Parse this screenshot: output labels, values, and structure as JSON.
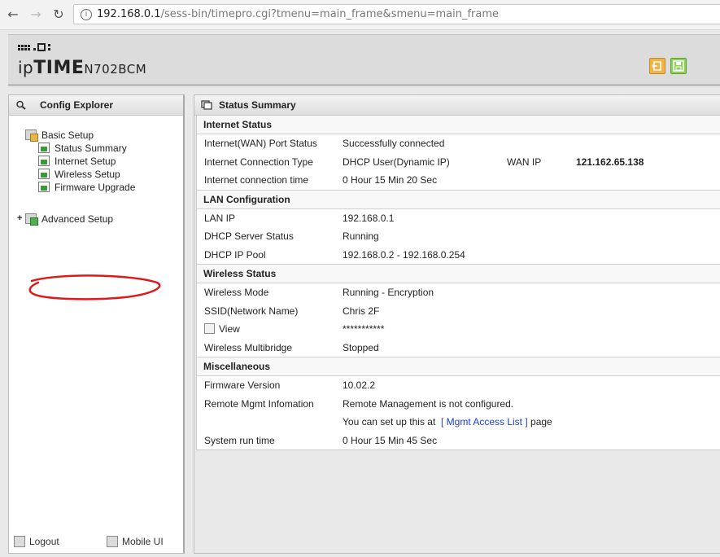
{
  "browser": {
    "url_host": "192.168.0.1",
    "url_path": "/sess-bin/timepro.cgi?tmenu=main_frame&smenu=main_frame"
  },
  "header": {
    "logo_ip": "ip",
    "logo_time": "TIME",
    "logo_model": "N702BCM"
  },
  "sidebar": {
    "title": "Config Explorer",
    "basic_setup": "Basic Setup",
    "items": [
      {
        "label": "Status Summary"
      },
      {
        "label": "Internet Setup"
      },
      {
        "label": "Wireless Setup"
      },
      {
        "label": "Firmware Upgrade"
      }
    ],
    "advanced_setup": "Advanced Setup",
    "expand_symbol": "+",
    "logout": "Logout",
    "mobile_ui": "Mobile UI"
  },
  "main": {
    "title": "Status Summary",
    "sections": {
      "internet": {
        "title": "Internet Status",
        "port_status_label": "Internet(WAN) Port Status",
        "port_status_value": "Successfully connected",
        "conn_type_label": "Internet Connection Type",
        "conn_type_value": "DHCP User(Dynamic IP)",
        "wan_ip_label": "WAN IP",
        "wan_ip_value": "121.162.65.138",
        "conn_time_label": "Internet connection time",
        "conn_time_value": "0 Hour 15 Min 20 Sec"
      },
      "lan": {
        "title": "LAN Configuration",
        "lan_ip_label": "LAN IP",
        "lan_ip_value": "192.168.0.1",
        "dhcp_status_label": "DHCP Server Status",
        "dhcp_status_value": "Running",
        "dhcp_pool_label": "DHCP IP Pool",
        "dhcp_pool_value": "192.168.0.2 -  192.168.0.254"
      },
      "wireless": {
        "title": "Wireless Status",
        "mode_label": "Wireless Mode",
        "mode_value": "Running - Encryption",
        "ssid_label": "SSID(Network Name)",
        "ssid_value": "Chris 2F",
        "view_label": "View",
        "view_checked": false,
        "password_value": "***********",
        "multibridge_label": "Wireless Multibridge",
        "multibridge_value": "Stopped"
      },
      "misc": {
        "title": "Miscellaneous",
        "firmware_label": "Firmware Version",
        "firmware_value": "10.02.2",
        "remote_label": "Remote Mgmt Infomation",
        "remote_value": "Remote Management is not configured.",
        "setup_prefix": "You can set up this at",
        "setup_link": "[ Mgmt Access List ]",
        "setup_suffix": "page",
        "runtime_label": "System run time",
        "runtime_value": "0 Hour 15 Min 45 Sec"
      }
    }
  },
  "colors": {
    "link": "#1a3cc8",
    "annotation": "#e01818",
    "logout_icon": "#f0b449",
    "save_icon": "#8fd05c"
  }
}
